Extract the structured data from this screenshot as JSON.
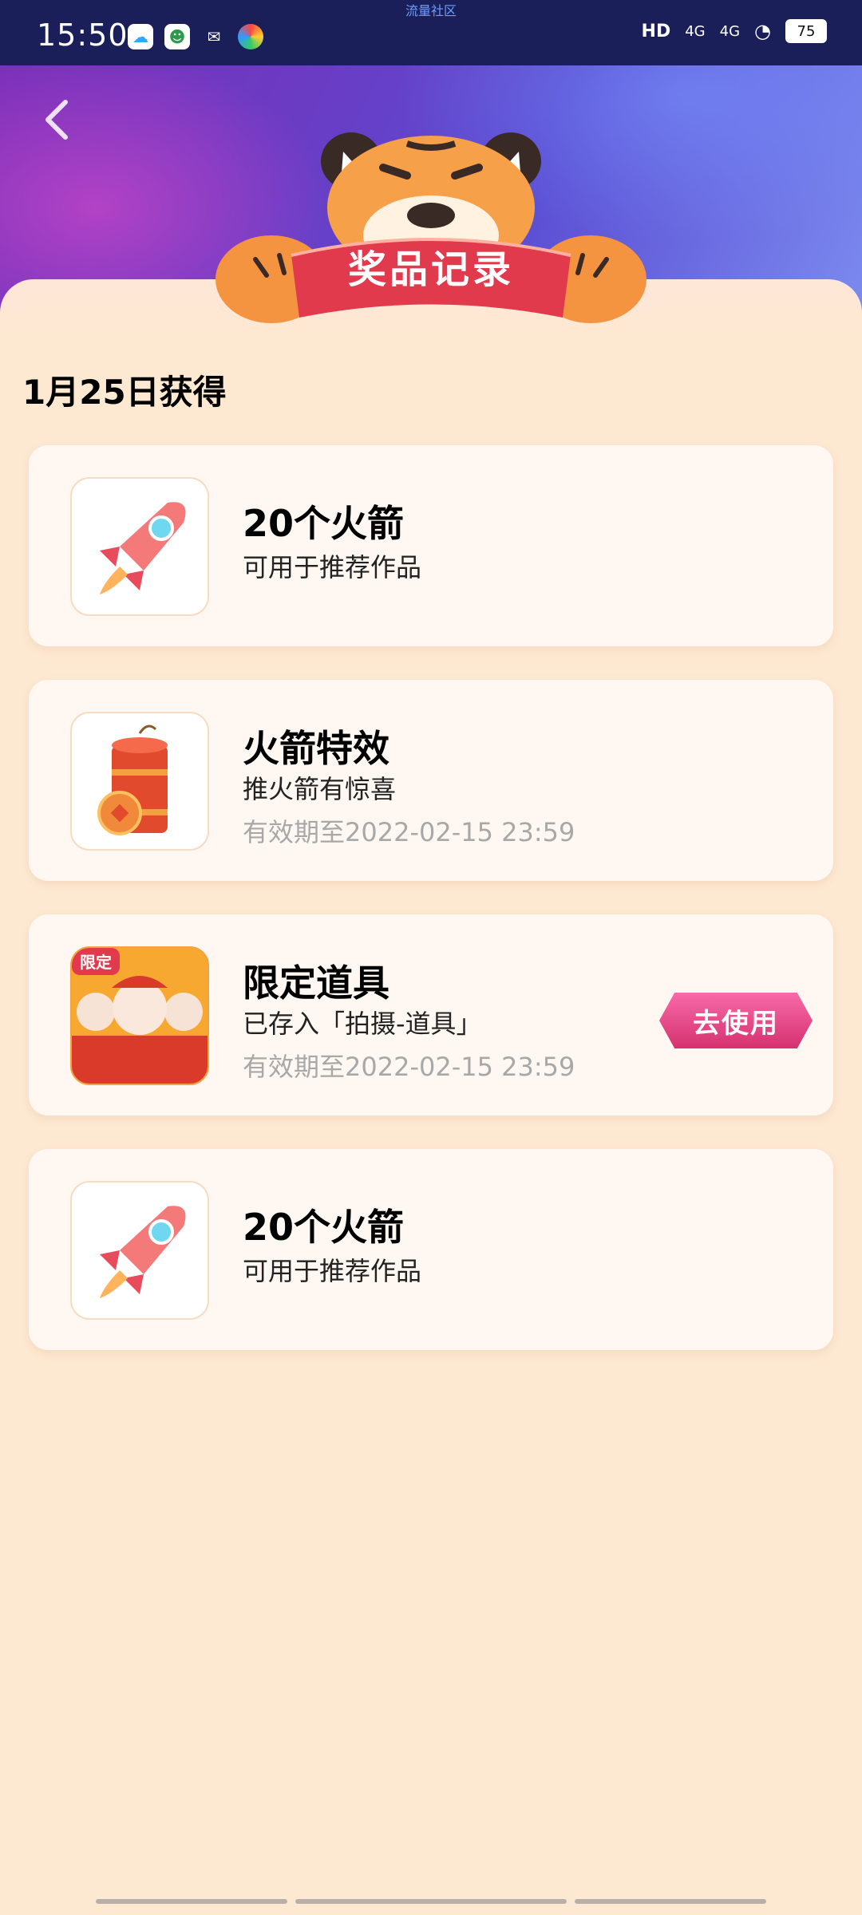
{
  "status_bar": {
    "time": "15:50",
    "carrier_tag": "流量社区",
    "signal_1": "4G",
    "signal_2": "4G",
    "battery": "75",
    "hd_label": "HD"
  },
  "header": {
    "banner_title": "奖品记录"
  },
  "section": {
    "date_title": "1月25日获得"
  },
  "cards": [
    {
      "title": "20个火箭",
      "desc": "可用于推荐作品",
      "expiry": "",
      "icon": "rocket-icon"
    },
    {
      "title": "火箭特效",
      "desc": "推火箭有惊喜",
      "expiry": "有效期至2022-02-15 23:59",
      "icon": "firecracker-icon"
    },
    {
      "title": "限定道具",
      "desc": "已存入「拍摄-道具」",
      "expiry": "有效期至2022-02-15 23:59",
      "icon": "props-icon",
      "badge": "限定",
      "button": "去使用"
    },
    {
      "title": "20个火箭",
      "desc": "可用于推荐作品",
      "expiry": "",
      "icon": "rocket-icon"
    }
  ],
  "colors": {
    "accent": "#d5326f",
    "page_bg": "#fde8d1",
    "banner_red": "#e23a4d"
  }
}
